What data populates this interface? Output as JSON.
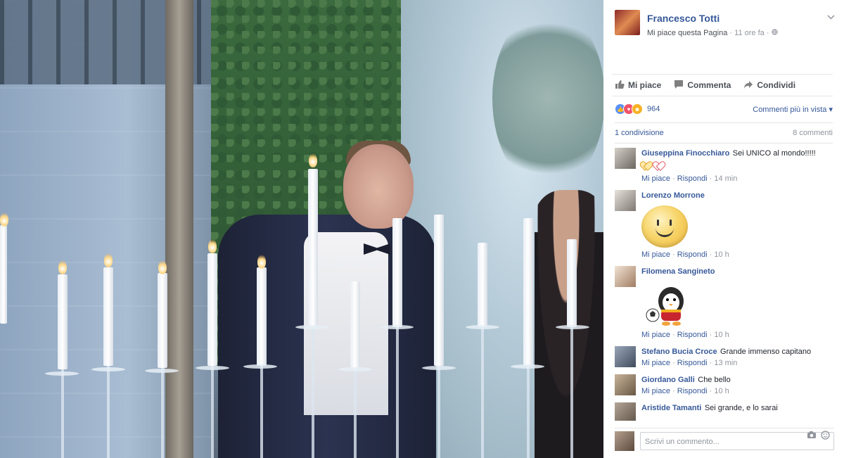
{
  "post": {
    "author": "Francesco Totti",
    "like_page": "Mi piace questa Pagina",
    "separator": "·",
    "time": "11 ore fa",
    "globe_icon": "globe-icon"
  },
  "actions": {
    "like": "Mi piace",
    "comment": "Commenta",
    "share": "Condividi"
  },
  "reactions": {
    "count": "964",
    "sort": "Commenti più in vista"
  },
  "stats": {
    "shares": "1 condivisione",
    "comments": "8 commenti"
  },
  "comments": [
    {
      "name": "Giuseppina Finocchiaro",
      "text": "Sei UNICO al mondo!!!!!",
      "like": "Mi piace",
      "reply": "Rispondi",
      "time": "14 min"
    },
    {
      "name": "Lorenzo Morrone",
      "text": "",
      "like": "Mi piace",
      "reply": "Rispondi",
      "time": "10 h"
    },
    {
      "name": "Filomena Sangineto",
      "text": "",
      "like": "Mi piace",
      "reply": "Rispondi",
      "time": "10 h"
    },
    {
      "name": "Stefano Bucia Croce",
      "text": "Grande immenso capitano",
      "like": "Mi piace",
      "reply": "Rispondi",
      "time": "13 min"
    },
    {
      "name": "Giordano Galli",
      "text": "Che bello",
      "like": "Mi piace",
      "reply": "Rispondi",
      "time": "10 h"
    },
    {
      "name": "Aristide Tamanti",
      "text": "Sei grande, e lo sarai",
      "like": "",
      "reply": "",
      "time": ""
    }
  ],
  "composer": {
    "placeholder": "Scrivi un commento..."
  },
  "colors": {
    "link": "#365899",
    "muted": "#90949c"
  }
}
